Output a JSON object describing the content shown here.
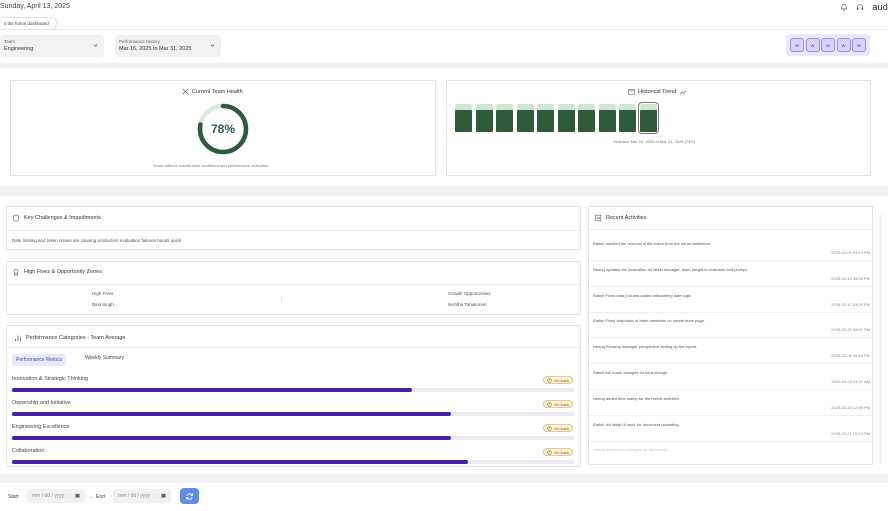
{
  "header": {
    "date": "Sunday, April 13, 2025",
    "tooltip": "s the home dashboard",
    "brand": "aud"
  },
  "filters": {
    "team_label": "Team",
    "team_value": "Engineering",
    "history_label": "Performance History",
    "history_value": "Mar 16, 2025 to Mar 31, 2025",
    "weeks": [
      "W",
      "W",
      "W",
      "W",
      "W"
    ]
  },
  "health": {
    "title": "Current Team Health",
    "score": 78,
    "score_text": "78%",
    "note": "Score reflects overall team sentiment and performance indicators",
    "color": "#2e5c3a"
  },
  "trend": {
    "title": "Historical Trend",
    "selected_note": "Selected: Mar 16, 2025 to Mar 31, 2025 (79%)",
    "values": [
      0.78,
      0.78,
      0.78,
      0.78,
      0.78,
      0.78,
      0.78,
      0.78,
      0.78,
      0.79
    ],
    "selected_index": 9
  },
  "challenges": {
    "title": "Key Challenges & Impediments",
    "text": "Rate limiting and token issues are causing production evaluation failures hands quick"
  },
  "highfives": {
    "title": "High Fives & Opportunity Zones",
    "col1_head": "High Fives",
    "col1_val": "Bind Singh",
    "col2_head": "Growth Opportunities",
    "col2_val": "Nishtha Tanukonon"
  },
  "performance": {
    "title": "Performance Categories - Team Average",
    "tab_active": "Performance Metrics",
    "tab_other": "Weekly Summary",
    "metrics": [
      {
        "label": "Innovation & Strategic Thinking",
        "value": 0.71,
        "status": "On track"
      },
      {
        "label": "Ownership and Initiative",
        "value": 0.78,
        "status": "On track"
      },
      {
        "label": "Engineering Excellence",
        "value": 0.78,
        "status": "On track"
      },
      {
        "label": "Collaboration",
        "value": 0.81,
        "status": "On track"
      }
    ],
    "accent": "#4a1fa8"
  },
  "activities": {
    "title": "Recent Activities",
    "items": [
      {
        "text": "Ratish handled the removal of file check from the return statement.",
        "time": "2025-02-09 09:13 PM"
      },
      {
        "text": "Neeraj updated the evaluation for latest manager, team insight to evaluator and prompt",
        "time": "2025-02-14 05:08 PM"
      },
      {
        "text": "Ratish Fixed data poll and added onboarding date logic",
        "time": "2025-02-17 03:09 PM"
      },
      {
        "text": "Ratish Fixed dropdown of team members on create team page.",
        "time": "2025-02-22 08:07 PM"
      },
      {
        "text": "Neeraj Revamp manager perspective setting up the layout.",
        "time": "2025-03-05 06:28 PM"
      },
      {
        "text": "Ratish the made changes for intra change.",
        "time": "2025-03-09 01:07 AM"
      },
      {
        "text": "Neeraj added time stamp for the recent activities",
        "time": "2025-03-18 12:39 PM"
      },
      {
        "text": "Ratish did initial UI work for document uploading.",
        "time": "2025-03-21 10:10 PM"
      },
      {
        "text": "Neeraj added new changes for the launch",
        "time": ""
      }
    ]
  },
  "footer": {
    "start_label": "Start",
    "end_label": "End",
    "start_placeholder": "mm / dd / yyyy",
    "end_placeholder": "mm / dd / yyyy",
    "separator": "→"
  }
}
